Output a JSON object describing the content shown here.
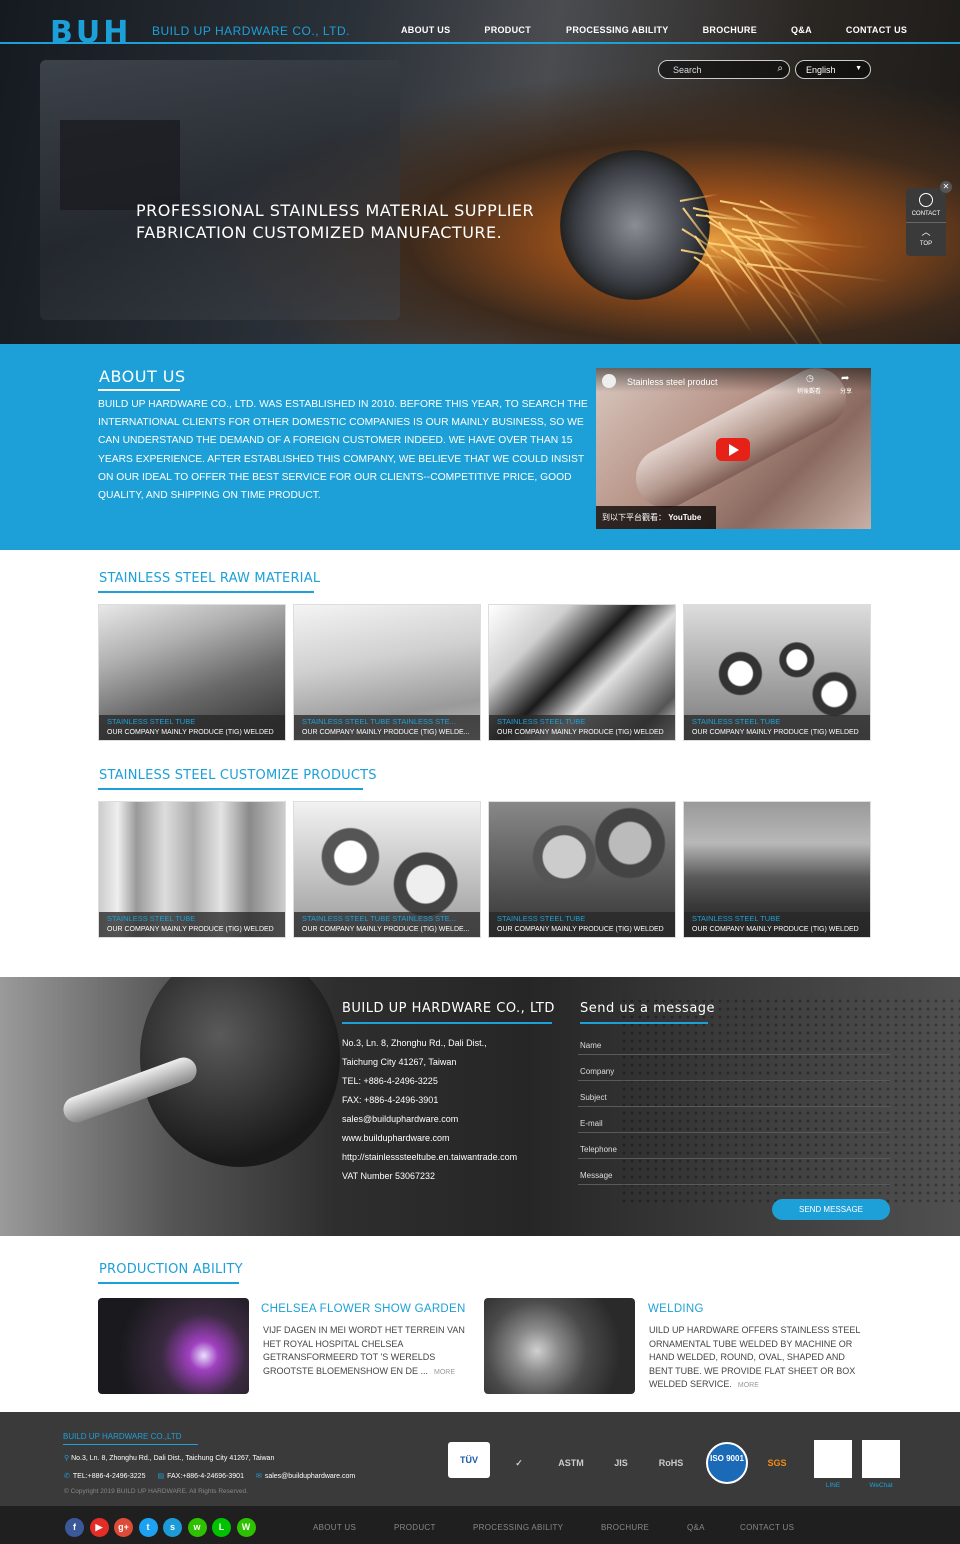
{
  "header": {
    "logo": "BUH",
    "company": "BUILD UP HARDWARE CO., LTD.",
    "nav": [
      "ABOUT US",
      "PRODUCT",
      "PROCESSING ABILITY",
      "BROCHURE",
      "Q&A",
      "CONTACT US"
    ],
    "search_placeholder": "Search",
    "language": "English",
    "slogan_line1": "PROFESSIONAL STAINLESS MATERIAL SUPPLIER",
    "slogan_line2": "FABRICATION CUSTOMIZED MANUFACTURE."
  },
  "float": {
    "contact": "CONTACT",
    "top": "TOP",
    "arrow": "︿",
    "close": "✕"
  },
  "about": {
    "title": "ABOUT US",
    "text": "BUILD UP HARDWARE CO., LTD. WAS ESTABLISHED IN 2010. BEFORE THIS YEAR, TO SEARCH THE INTERNATIONAL CLIENTS FOR OTHER DOMESTIC COMPANIES IS OUR MAINLY BUSINESS, SO WE CAN UNDERSTAND THE DEMAND OF A FOREIGN CUSTOMER INDEED. WE HAVE OVER THAN 15 YEARS EXPERIENCE. AFTER ESTABLISHED THIS COMPANY, WE BELIEVE THAT WE COULD INSIST ON OUR IDEAL TO OFFER THE BEST SERVICE FOR OUR CLIENTS--COMPETITIVE PRICE, GOOD QUALITY, AND SHIPPING ON TIME PRODUCT.",
    "video": {
      "title": "Stainless steel product",
      "watch_later": "稍後觀看",
      "share": "分享",
      "watch_on": "到以下平台觀看：",
      "platform": "YouTube"
    }
  },
  "raw_material": {
    "title": "STAINLESS STEEL RAW MATERIAL",
    "cards": [
      {
        "title": "STAINLESS STEEL TUBE",
        "desc": "OUR COMPANY MAINLY PRODUCE (TIG) WELDED"
      },
      {
        "title": "STAINLESS STEEL TUBE STAINLESS STE...",
        "desc": "OUR COMPANY MAINLY PRODUCE (TIG) WELDE..."
      },
      {
        "title": "STAINLESS STEEL TUBE",
        "desc": "OUR COMPANY MAINLY PRODUCE (TIG) WELDED"
      },
      {
        "title": "STAINLESS STEEL TUBE",
        "desc": "OUR COMPANY MAINLY PRODUCE (TIG) WELDED"
      }
    ]
  },
  "customize": {
    "title": "STAINLESS STEEL CUSTOMIZE PRODUCTS",
    "cards": [
      {
        "title": "STAINLESS STEEL TUBE",
        "desc": "OUR COMPANY MAINLY PRODUCE (TIG) WELDED"
      },
      {
        "title": "STAINLESS STEEL TUBE STAINLESS STE...",
        "desc": "OUR COMPANY MAINLY PRODUCE (TIG) WELDE..."
      },
      {
        "title": "STAINLESS STEEL TUBE",
        "desc": "OUR COMPANY MAINLY PRODUCE (TIG) WELDED"
      },
      {
        "title": "STAINLESS STEEL TUBE",
        "desc": "OUR COMPANY MAINLY PRODUCE (TIG) WELDED"
      }
    ]
  },
  "contact": {
    "title": "BUILD UP HARDWARE CO., LTD",
    "info": [
      "No.3, Ln. 8, Zhonghu Rd., Dali Dist.,",
      "Taichung City 41267, Taiwan",
      "TEL: +886-4-2496-3225",
      "FAX: +886-4-2496-3901",
      "sales@builduphardware.com",
      "www.builduphardware.com",
      "http://stainlesssteeltube.en.taiwantrade.com",
      "VAT Number 53067232"
    ],
    "form_title": "Send us a message",
    "fields": [
      "Name",
      "Company",
      "Subject",
      "E-mail",
      "Telephone",
      "Message"
    ],
    "send": "SEND MESSAGE"
  },
  "production": {
    "title": "PRODUCTION ABILITY",
    "items": [
      {
        "title": "CHELSEA FLOWER SHOW GARDEN",
        "text": "VIJF DAGEN IN MEI WORDT HET TERREIN VAN HET ROYAL HOSPITAL CHELSEA GETRANSFORMEERD TOT 'S WERELDS GROOTSTE BLOEMENSHOW EN DE ...",
        "more": "MORE"
      },
      {
        "title": "WELDING",
        "text": "UILD UP HARDWARE OFFERS STAINLESS STEEL ORNAMENTAL TUBE WELDED BY MACHINE OR HAND WELDED, ROUND, OVAL, SHAPED AND BENT TUBE. WE PROVIDE FLAT SHEET OR BOX WELDED SERVICE.",
        "more": "MORE"
      }
    ]
  },
  "footer": {
    "title": "BUILD UP HARDWARE CO.,LTD",
    "address": "No.3, Ln. 8, Zhonghu Rd., Dali Dist., Taichung City 41267, Taiwan",
    "tel": "TEL:+886-4-2496-3225",
    "fax": "FAX:+886-4-24696-3901",
    "email": "sales@builduphardware.com",
    "copyright": "© Copyright 2019 BUILD UP HARDWARE. All Rights Reserved.",
    "certs": [
      "TÜV",
      "✓",
      "ASTM",
      "JIS",
      "RoHS",
      "ISO 9001",
      "SGS"
    ],
    "qr_labels": [
      "LINE",
      "WeChat"
    ],
    "social": [
      "f",
      "▶",
      "g+",
      "t",
      "s",
      "w",
      "L",
      "W"
    ],
    "nav": [
      "ABOUT US",
      "PRODUCT",
      "PROCESSING ABILITY",
      "BROCHURE",
      "Q&A",
      "CONTACT US"
    ]
  },
  "colors": {
    "accent": "#1da0d8",
    "dark": "#3a3a3a"
  }
}
